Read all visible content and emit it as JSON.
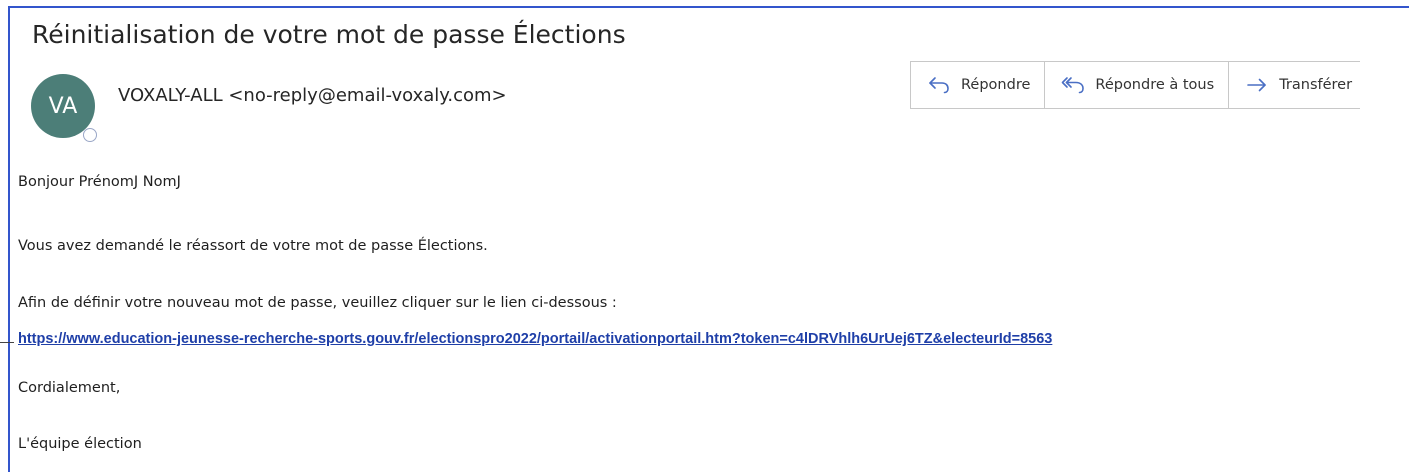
{
  "email": {
    "subject": "Réinitialisation de votre mot de passe Élections",
    "avatar_initials": "VA",
    "avatar_color": "#4c7e78",
    "sender": "VOXALY-ALL <no-reply@email-voxaly.com>"
  },
  "actions": [
    {
      "label": "Répondre",
      "icon": "reply-icon"
    },
    {
      "label": "Répondre à tous",
      "icon": "reply-all-icon"
    },
    {
      "label": "Transférer",
      "icon": "forward-icon"
    }
  ],
  "body": {
    "greeting": "Bonjour PrénomJ NomJ",
    "line1": "Vous avez demandé le réassort de votre mot de passe Élections.",
    "line2": "Afin de définir votre nouveau mot de passe, veuillez cliquer sur le lien ci-dessous :",
    "link": "https://www.education-jeunesse-recherche-sports.gouv.fr/electionspro2022/portail/activationportail.htm?token=c4lDRVhlh6UrUej6TZ&electeurId=8563",
    "closing": "Cordialement,",
    "signature": "L'équipe élection"
  },
  "colors": {
    "accent": "#3355cc",
    "link": "#1f3fa8",
    "icon": "#4a6fc4"
  }
}
